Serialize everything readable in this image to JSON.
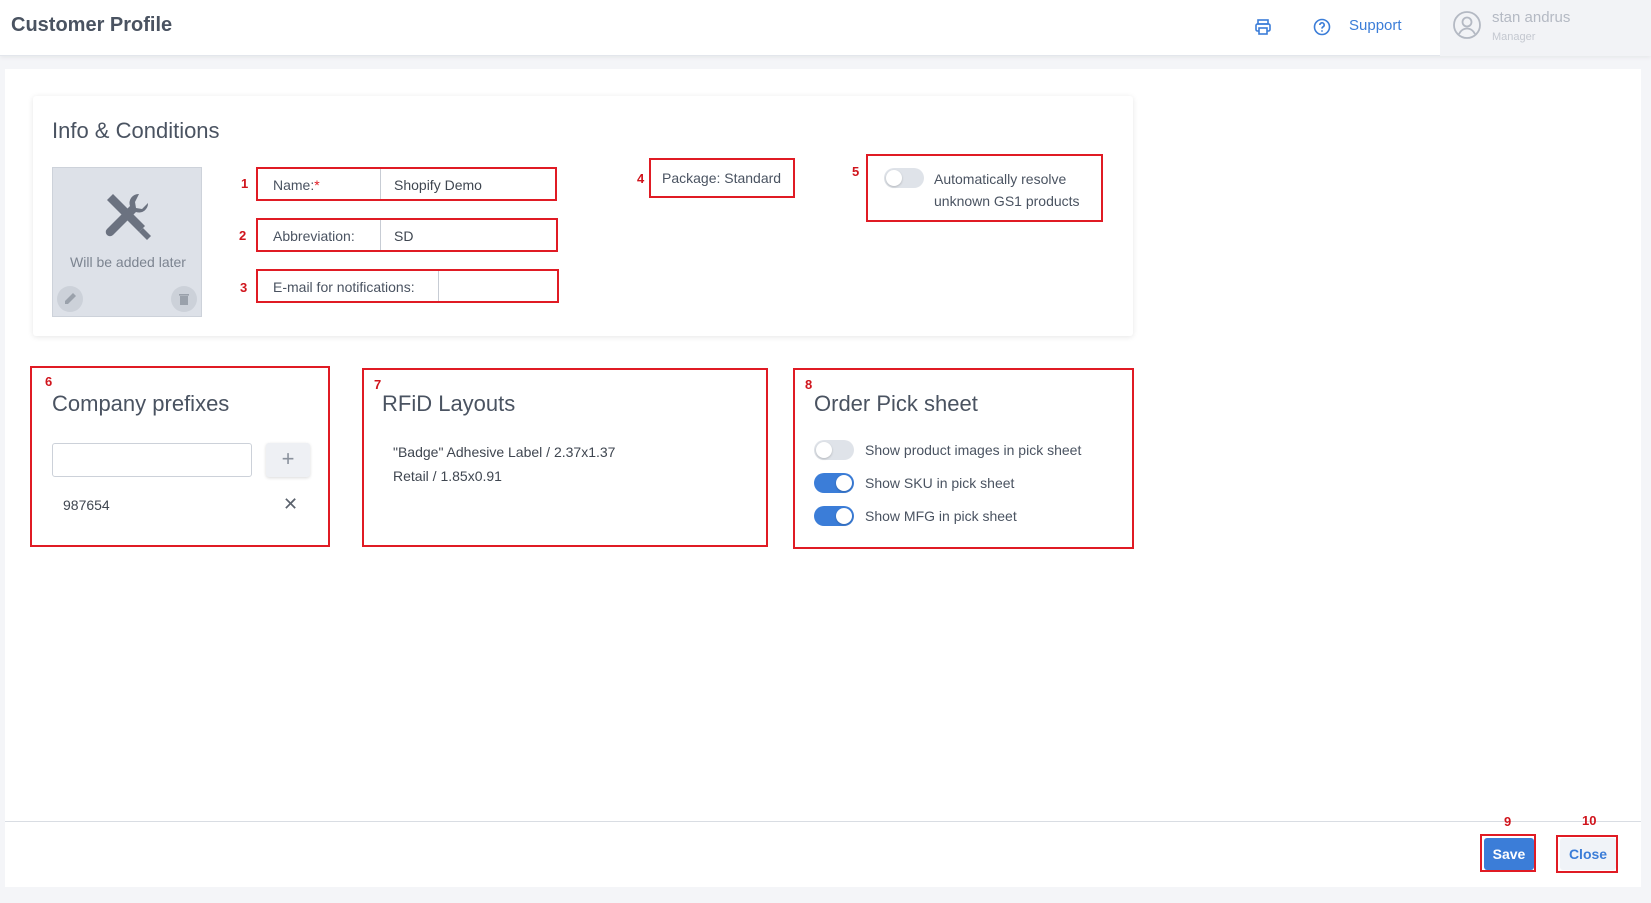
{
  "header": {
    "title": "Customer Profile",
    "print_icon": "printer-icon",
    "help_icon": "question-circle-icon",
    "support_label": "Support",
    "user": {
      "name": "stan andrus",
      "role": "Manager",
      "avatar_icon": "user-circle-icon"
    }
  },
  "info": {
    "title": "Info & Conditions",
    "image_placeholder": "Will be added later",
    "image_icon": "tools-icon",
    "edit_icon": "pencil-icon",
    "delete_icon": "trash-icon",
    "name_label": "Name:",
    "name_required": "*",
    "name_value": "Shopify Demo",
    "abbr_label": "Abbreviation:",
    "abbr_value": "SD",
    "email_label": "E-mail for notifications:",
    "email_value": "",
    "package_label": "Package: Standard",
    "auto_resolve_label": "Automatically resolve unknown GS1 products",
    "auto_resolve_on": false
  },
  "prefixes": {
    "title": "Company prefixes",
    "input_value": "",
    "add_label": "+",
    "items": [
      "987654"
    ],
    "remove_icon": "close-x-icon"
  },
  "rfid": {
    "title": "RFiD Layouts",
    "items": [
      "\"Badge\" Adhesive Label / 2.37x1.37",
      "Retail / 1.85x0.91"
    ]
  },
  "pick_sheet": {
    "title": "Order Pick sheet",
    "options": [
      {
        "label": "Show product images in pick sheet",
        "on": false
      },
      {
        "label": "Show SKU in pick sheet",
        "on": true
      },
      {
        "label": "Show MFG in pick sheet",
        "on": true
      }
    ]
  },
  "annotations": [
    "1",
    "2",
    "3",
    "4",
    "5",
    "6",
    "7",
    "8",
    "9",
    "10"
  ],
  "footer": {
    "save_label": "Save",
    "close_label": "Close"
  },
  "colors": {
    "accent": "#3b7dd8",
    "annotation": "#e01b24",
    "toggle_off": "#dfe3e9"
  }
}
